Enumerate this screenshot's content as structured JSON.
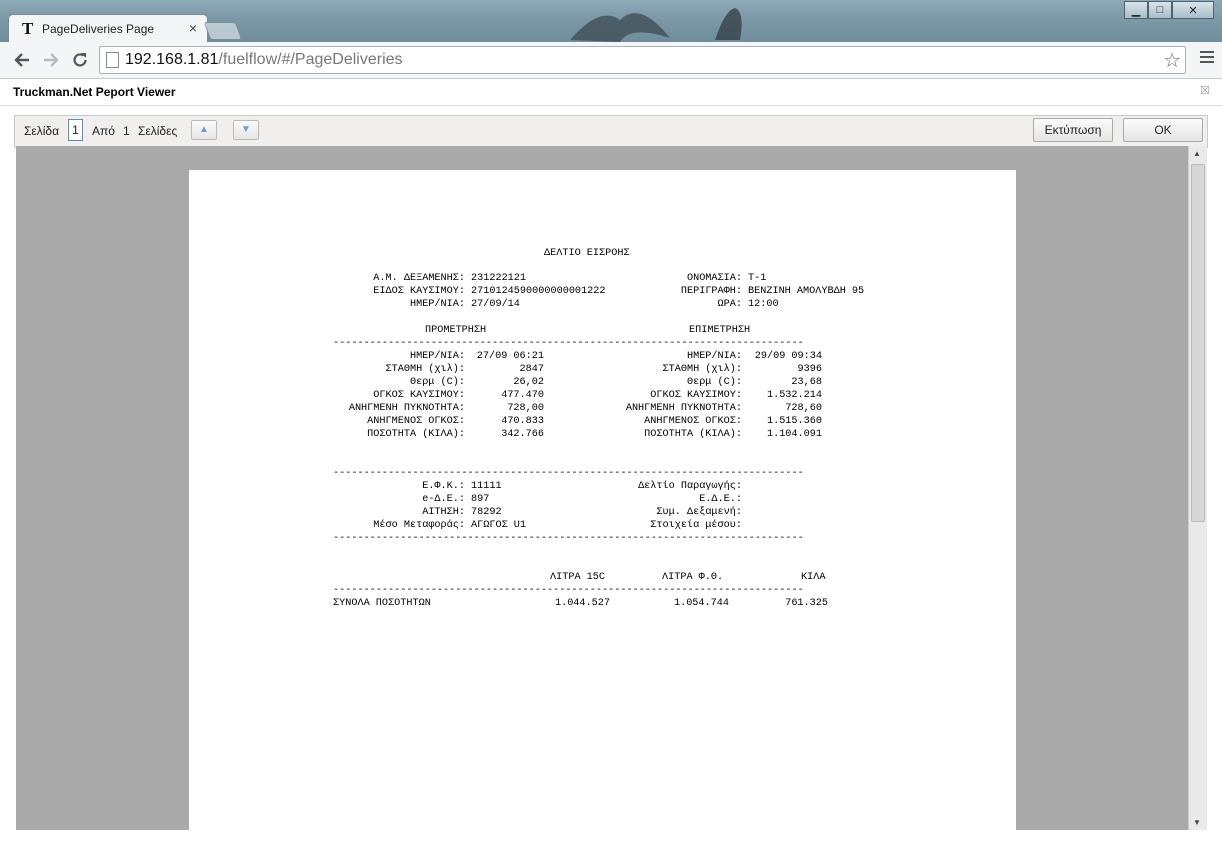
{
  "browser": {
    "tab_title": "PageDeliveries Page",
    "tab_close": "×",
    "favicon": "T",
    "url_host": "192.168.1.81",
    "url_path": "/fuelflow/#/PageDeliveries",
    "minimize": "▁",
    "maximize": "□",
    "close": "✕"
  },
  "viewer": {
    "title": "Truckman.Net Peport Viewer",
    "close": "☒",
    "pager": {
      "page_label": "Σελίδα",
      "page_value": "1",
      "of_label": "Από",
      "total": "1",
      "pages_label": "Σελίδες",
      "print_button": "Εκτύπωση",
      "ok_button": "OK"
    }
  },
  "report": {
    "title": "ΔΕΛΤΙΟ ΕΙΣΡΟΗΣ",
    "header_left": [
      {
        "label": "Α.Μ. ΔΕΞΑΜΕΝΗΣ:",
        "value": "231222121"
      },
      {
        "label": "ΕΙΔΟΣ ΚΑΥΣΙΜΟΥ:",
        "value": "2710124590000000001222"
      },
      {
        "label": "ΗΜΕΡ/ΝΙΑ:",
        "value": "27/09/14"
      }
    ],
    "header_right": [
      {
        "label": "ΟΝΟΜΑΣΙΑ:",
        "value": "T-1"
      },
      {
        "label": "ΠΕΡΙΓΡΑΦΗ:",
        "value": "ΒΕΝΖΙΝΗ ΑΜΟΛΥΒΔΗ 95"
      },
      {
        "label": "ΩΡΑ:",
        "value": "12:00"
      }
    ],
    "before_heading": "ΠΡΟΜΕΤΡΗΣΗ",
    "after_heading": "ΕΠΙΜΕΤΡΗΣΗ",
    "dashes": "-----------------------------------------------------------------------------",
    "before": [
      {
        "label": "ΗΜΕΡ/ΝΙΑ:",
        "value": "27/09 06:21"
      },
      {
        "label": "ΣΤΑΘΜΗ (χιλ):",
        "value": "2847"
      },
      {
        "label": "Θερμ (C):",
        "value": "26,02"
      },
      {
        "label": "ΟΓΚΟΣ ΚΑΥΣΙΜΟΥ:",
        "value": "477.470"
      },
      {
        "label": "ΑΝΗΓΜΕΝΗ ΠΥΚΝΟΤΗΤΑ:",
        "value": "728,00"
      },
      {
        "label": "ΑΝΗΓΜΕΝΟΣ ΟΓΚΟΣ:",
        "value": "470.833"
      },
      {
        "label": "ΠΟΣΟΤΗΤΑ (ΚΙΛΑ):",
        "value": "342.766"
      }
    ],
    "after": [
      {
        "label": "ΗΜΕΡ/ΝΙΑ:",
        "value": "29/09 09:34"
      },
      {
        "label": "ΣΤΑΘΜΗ (χιλ):",
        "value": "9396"
      },
      {
        "label": "Θερμ (C):",
        "value": "23,68"
      },
      {
        "label": "ΟΓΚΟΣ ΚΑΥΣΙΜΟΥ:",
        "value": "1.532.214"
      },
      {
        "label": "ΑΝΗΓΜΕΝΗ ΠΥΚΝΟΤΗΤΑ:",
        "value": "728,60"
      },
      {
        "label": "ΑΝΗΓΜΕΝΟΣ ΟΓΚΟΣ:",
        "value": "1.515.360"
      },
      {
        "label": "ΠΟΣΟΤΗΤΑ (ΚΙΛΑ):",
        "value": "1.104.091"
      }
    ],
    "info_left": [
      {
        "label": "Ε.Φ.Κ.:",
        "value": "11111"
      },
      {
        "label": "e-Δ.Ε.:",
        "value": "897"
      },
      {
        "label": "ΑΙΤΗΣΗ:",
        "value": "78292"
      },
      {
        "label": "Μέσο Μεταφοράς:",
        "value": "ΑΓΩΓΟΣ U1"
      }
    ],
    "info_right": [
      {
        "label": "Δελτίο Παραγωγής:",
        "value": ""
      },
      {
        "label": "Ε.Δ.Ε.:",
        "value": ""
      },
      {
        "label": "Συμ. Δεξαμενή:",
        "value": ""
      },
      {
        "label": "Στοιχεία μέσου:",
        "value": ""
      }
    ],
    "totals_headers": [
      "ΛΙΤΡΑ 15C",
      "ΛΙΤΡΑ Φ.Θ.",
      "ΚΙΛΑ"
    ],
    "totals_label": "ΣΥΝΟΛΑ ΠΟΣΟΤΗΤΩΝ",
    "totals_values": [
      "1.044.527",
      "1.054.744",
      "761.325"
    ]
  }
}
